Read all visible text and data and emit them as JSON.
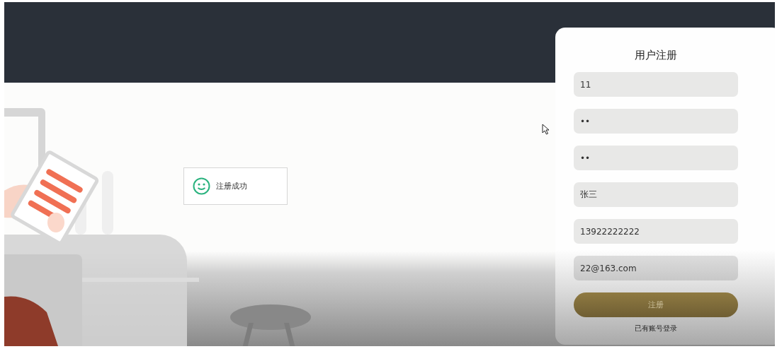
{
  "toast": {
    "message": "注册成功"
  },
  "form": {
    "title": "用户注册",
    "fields": [
      {
        "value": "11"
      },
      {
        "value": "••"
      },
      {
        "value": "••"
      },
      {
        "value": "张三"
      },
      {
        "value": "13922222222"
      },
      {
        "value": "22@163.com"
      }
    ],
    "submit": "注册",
    "login_link": "已有账号登录"
  }
}
